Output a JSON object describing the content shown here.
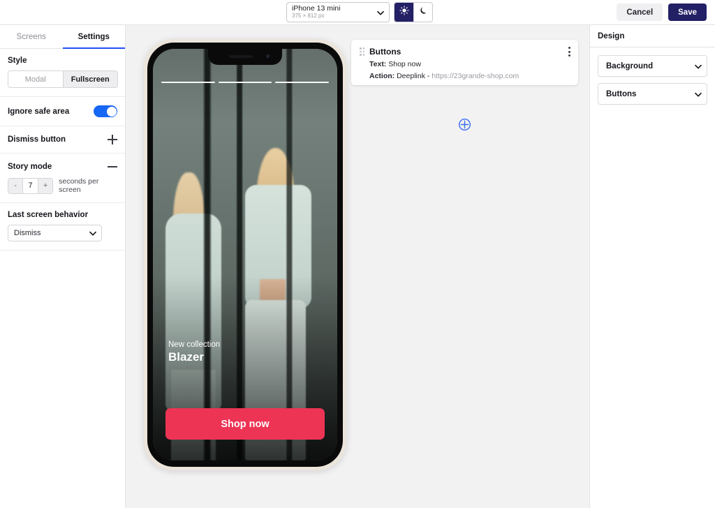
{
  "topbar": {
    "device": {
      "name": "iPhone 13 mini",
      "size": "375 × 812 px"
    },
    "light_icon": "sun-icon",
    "dark_icon": "moon-icon",
    "cancel_label": "Cancel",
    "save_label": "Save",
    "accent_navy": "#232066"
  },
  "sidebar": {
    "tabs": [
      {
        "label": "Screens",
        "active": false
      },
      {
        "label": "Settings",
        "active": true
      }
    ],
    "active_tab_color": "#2250f4",
    "style": {
      "label": "Style",
      "options": [
        {
          "label": "Modal",
          "selected": false
        },
        {
          "label": "Fullscreen",
          "selected": true
        }
      ]
    },
    "ignore_safe_area": {
      "label": "Ignore safe area",
      "value": "on",
      "color": "#1767f5"
    },
    "dismiss_button": {
      "label": "Dismiss button",
      "icon": "plus-icon"
    },
    "story_mode": {
      "label": "Story mode",
      "icon": "minus-icon"
    },
    "stepper": {
      "decrement": "-",
      "value": "7",
      "increment": "+",
      "unit": "seconds per screen"
    },
    "last_screen_behavior": {
      "label": "Last screen behavior",
      "value": "Dismiss",
      "options": [
        "Dismiss"
      ]
    }
  },
  "canvas": {
    "phone": {
      "story_segments": 3,
      "overlay_subtitle": "New collection",
      "overlay_title": "Blazer",
      "cta_label": "Shop now",
      "cta_color": "#ee3455"
    },
    "block": {
      "title": "Buttons",
      "text_label": "Text:",
      "text_value": "Shop now",
      "action_label": "Action:",
      "action_value": "Deeplink -",
      "action_url": "https://23grande-shop.com"
    },
    "add_block_icon": "plus-circle-icon"
  },
  "rightpanel": {
    "title": "Design",
    "sections": [
      {
        "label": "Background"
      },
      {
        "label": "Buttons"
      }
    ]
  }
}
